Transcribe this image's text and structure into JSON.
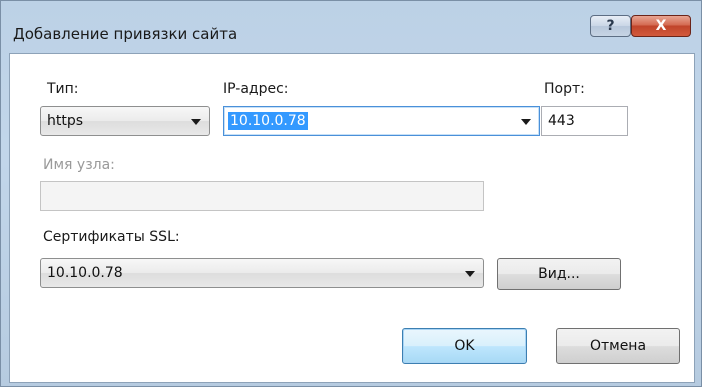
{
  "window": {
    "title": "Добавление привязки сайта",
    "help_label": "?",
    "close_label": "X"
  },
  "form": {
    "type_label": "Тип:",
    "type_value": "https",
    "ip_label": "IP-адрес:",
    "ip_value": "10.10.0.78",
    "port_label": "Порт:",
    "port_value": "443",
    "hostname_label": "Имя узла:",
    "hostname_value": "",
    "ssl_label": "Сертификаты SSL:",
    "ssl_value": "10.10.0.78"
  },
  "buttons": {
    "view": "Вид...",
    "ok": "OK",
    "cancel": "Отмена"
  }
}
